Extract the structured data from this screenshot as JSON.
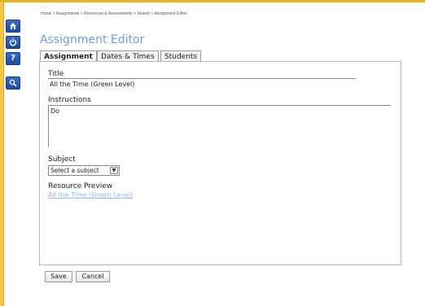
{
  "breadcrumb": "Home > Assignments > Resources & Assessments > Search > Assignment Editor",
  "page_title": "Assignment Editor",
  "tabs": [
    {
      "label": "Assignment",
      "active": true
    },
    {
      "label": "Dates & Times",
      "active": false
    },
    {
      "label": "Students",
      "active": false
    }
  ],
  "form": {
    "title_label": "Title",
    "title_value": "All the Time (Green Level)",
    "instructions_label": "Instructions",
    "instructions_value": "Do",
    "subject_label": "Subject",
    "subject_selected": "Select a subject",
    "resource_preview_label": "Resource Preview",
    "resource_preview_link": "All the Time (Green Level)"
  },
  "actions": {
    "save_label": "Save",
    "cancel_label": "Cancel"
  },
  "side_rail": [
    {
      "icon": "home-icon",
      "glyph": ""
    },
    {
      "icon": "power-icon",
      "glyph": ""
    },
    {
      "icon": "help-icon",
      "glyph": "?"
    },
    {
      "icon": "search-icon",
      "glyph": ""
    }
  ],
  "colors": {
    "accent_yellow": "#e6b320",
    "title_blue": "#6a9edb",
    "link_blue": "#8fb6e3",
    "rail_blue": "#2b5bb5"
  }
}
